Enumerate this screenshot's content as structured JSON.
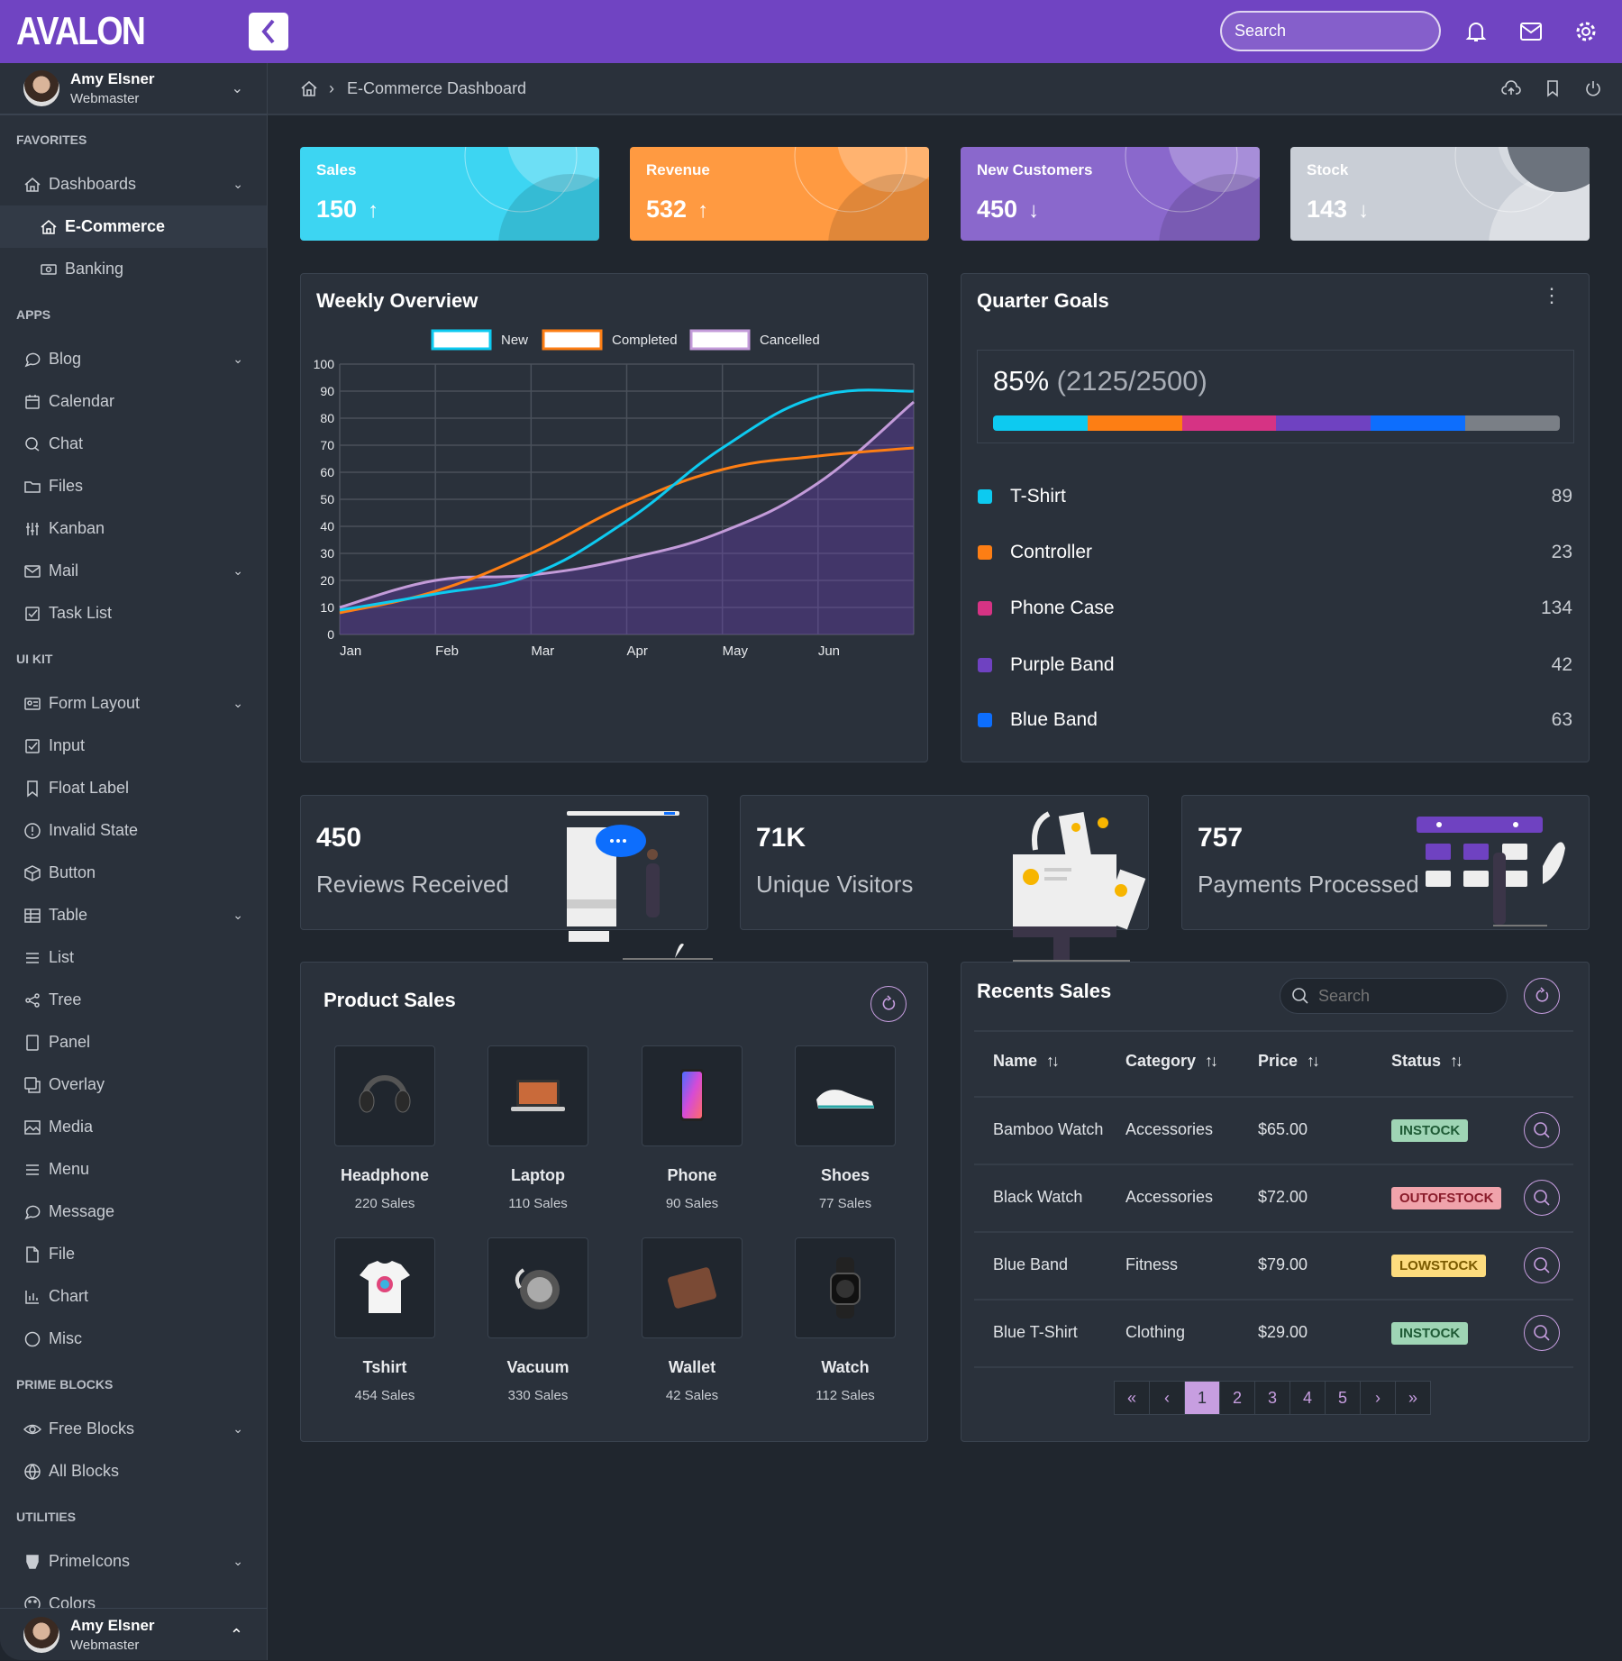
{
  "app": {
    "logo": "AVALON"
  },
  "topbar": {
    "search_placeholder": "Search",
    "icons": [
      "bell-icon",
      "mail-icon",
      "gear-icon"
    ]
  },
  "user": {
    "name": "Amy Elsner",
    "role": "Webmaster"
  },
  "breadcrumb": {
    "current": "E-Commerce Dashboard",
    "actions": [
      "cloud-upload-icon",
      "bookmark-icon",
      "power-icon"
    ]
  },
  "sidebar": {
    "sections": [
      {
        "title": "FAVORITES",
        "items": [
          {
            "label": "Dashboards",
            "icon": "home",
            "expandable": true
          },
          {
            "label": "E-Commerce",
            "icon": "home",
            "sub": true,
            "active": true
          },
          {
            "label": "Banking",
            "icon": "money",
            "sub": true
          }
        ]
      },
      {
        "title": "APPS",
        "items": [
          {
            "label": "Blog",
            "icon": "comment",
            "expandable": true
          },
          {
            "label": "Calendar",
            "icon": "calendar"
          },
          {
            "label": "Chat",
            "icon": "comments"
          },
          {
            "label": "Files",
            "icon": "folder"
          },
          {
            "label": "Kanban",
            "icon": "sliders"
          },
          {
            "label": "Mail",
            "icon": "envelope",
            "expandable": true
          },
          {
            "label": "Task List",
            "icon": "check-square"
          }
        ]
      },
      {
        "title": "UI KIT",
        "items": [
          {
            "label": "Form Layout",
            "icon": "id-card",
            "expandable": true
          },
          {
            "label": "Input",
            "icon": "check-square"
          },
          {
            "label": "Float Label",
            "icon": "bookmark"
          },
          {
            "label": "Invalid State",
            "icon": "exclamation-circle"
          },
          {
            "label": "Button",
            "icon": "box"
          },
          {
            "label": "Table",
            "icon": "table",
            "expandable": true
          },
          {
            "label": "List",
            "icon": "list"
          },
          {
            "label": "Tree",
            "icon": "share"
          },
          {
            "label": "Panel",
            "icon": "tablet"
          },
          {
            "label": "Overlay",
            "icon": "clone"
          },
          {
            "label": "Media",
            "icon": "image"
          },
          {
            "label": "Menu",
            "icon": "bars"
          },
          {
            "label": "Message",
            "icon": "comment"
          },
          {
            "label": "File",
            "icon": "file"
          },
          {
            "label": "Chart",
            "icon": "chart-bar"
          },
          {
            "label": "Misc",
            "icon": "circle"
          }
        ]
      },
      {
        "title": "PRIME BLOCKS",
        "items": [
          {
            "label": "Free Blocks",
            "icon": "eye",
            "expandable": true
          },
          {
            "label": "All Blocks",
            "icon": "globe"
          }
        ]
      },
      {
        "title": "UTILITIES",
        "items": [
          {
            "label": "PrimeIcons",
            "icon": "prime",
            "expandable": true
          },
          {
            "label": "Colors",
            "icon": "palette"
          }
        ]
      }
    ]
  },
  "kpis": [
    {
      "label": "Sales",
      "value": "150",
      "trend": "up",
      "color": "#3dd5f2"
    },
    {
      "label": "Revenue",
      "value": "532",
      "trend": "up",
      "color": "#ff9a41"
    },
    {
      "label": "New Customers",
      "value": "450",
      "trend": "down",
      "color": "#8a68cc"
    },
    {
      "label": "Stock",
      "value": "143",
      "trend": "down",
      "color": "#c9ced6"
    }
  ],
  "weekly": {
    "title": "Weekly Overview"
  },
  "chart_data": {
    "type": "line",
    "categories": [
      "Jan",
      "Feb",
      "Mar",
      "Apr",
      "May",
      "Jun"
    ],
    "ylim": [
      0,
      100
    ],
    "yticks": [
      0,
      10,
      20,
      30,
      40,
      50,
      60,
      70,
      80,
      90,
      100
    ],
    "grid": true,
    "legend": "top",
    "series": [
      {
        "name": "New",
        "color": "#0dcaf0",
        "fill": false,
        "values": [
          9,
          15,
          22,
          42,
          69,
          88,
          90
        ]
      },
      {
        "name": "Completed",
        "color": "#fd7e14",
        "fill": false,
        "values": [
          8,
          16,
          30,
          48,
          61,
          66,
          69
        ]
      },
      {
        "name": "Cancelled",
        "color": "#c39bd9",
        "fill": true,
        "values": [
          10,
          20,
          22,
          28,
          38,
          56,
          86
        ]
      }
    ]
  },
  "quarter": {
    "title": "Quarter Goals",
    "percent_label": "85%",
    "ratio_label": "(2125/2500)",
    "progress_segments": [
      "#0dcaf0",
      "#fd7e14",
      "#d63384",
      "#6f42c1",
      "#0d6efd",
      "#7a7f86"
    ],
    "items": [
      {
        "name": "T-Shirt",
        "count": "89",
        "color": "#0dcaf0"
      },
      {
        "name": "Controller",
        "count": "23",
        "color": "#fd7e14"
      },
      {
        "name": "Phone Case",
        "count": "134",
        "color": "#d63384"
      },
      {
        "name": "Purple Band",
        "count": "42",
        "color": "#6f42c1"
      },
      {
        "name": "Blue Band",
        "count": "63",
        "color": "#0d6efd"
      }
    ]
  },
  "stats": [
    {
      "value": "450",
      "label": "Reviews Received"
    },
    {
      "value": "71K",
      "label": "Unique Visitors"
    },
    {
      "value": "757",
      "label": "Payments Processed"
    }
  ],
  "product_sales": {
    "title": "Product Sales",
    "items": [
      {
        "name": "Headphone",
        "sales": "220 Sales",
        "img": "headphone"
      },
      {
        "name": "Laptop",
        "sales": "110 Sales",
        "img": "laptop"
      },
      {
        "name": "Phone",
        "sales": "90 Sales",
        "img": "phone"
      },
      {
        "name": "Shoes",
        "sales": "77 Sales",
        "img": "shoes"
      },
      {
        "name": "Tshirt",
        "sales": "454 Sales",
        "img": "tshirt"
      },
      {
        "name": "Vacuum",
        "sales": "330 Sales",
        "img": "vacuum"
      },
      {
        "name": "Wallet",
        "sales": "42 Sales",
        "img": "wallet"
      },
      {
        "name": "Watch",
        "sales": "112 Sales",
        "img": "watch"
      }
    ]
  },
  "recent_sales": {
    "title": "Recents Sales",
    "search_placeholder": "Search",
    "columns": [
      "Name",
      "Category",
      "Price",
      "Status"
    ],
    "rows": [
      {
        "name": "Bamboo Watch",
        "category": "Accessories",
        "price": "$65.00",
        "status": "INSTOCK"
      },
      {
        "name": "Black Watch",
        "category": "Accessories",
        "price": "$72.00",
        "status": "OUTOFSTOCK"
      },
      {
        "name": "Blue Band",
        "category": "Fitness",
        "price": "$79.00",
        "status": "LOWSTOCK"
      },
      {
        "name": "Blue T-Shirt",
        "category": "Clothing",
        "price": "$29.00",
        "status": "INSTOCK"
      }
    ],
    "status_colors": {
      "INSTOCK": {
        "bg": "#9fd5b5",
        "fg": "#1e5a35"
      },
      "OUTOFSTOCK": {
        "bg": "#f0a3ab",
        "fg": "#8a1c2b"
      },
      "LOWSTOCK": {
        "bg": "#fddc7e",
        "fg": "#7a5a00"
      }
    },
    "pagination": {
      "pages": [
        "1",
        "2",
        "3",
        "4",
        "5"
      ],
      "current": "1",
      "first": "«",
      "prev": "‹",
      "next": "›",
      "last": "»"
    }
  }
}
